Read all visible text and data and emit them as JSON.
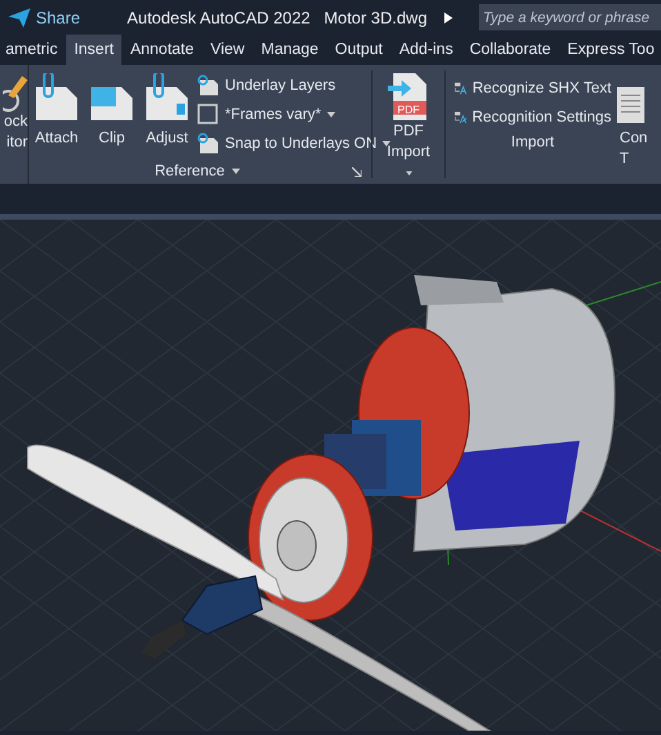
{
  "title_bar": {
    "share": "Share",
    "title": "Autodesk AutoCAD 2022",
    "filename": "Motor 3D.dwg",
    "search": {
      "placeholder": "Type a keyword or phrase"
    }
  },
  "tabs": [
    {
      "label": "ametric",
      "selected": false
    },
    {
      "label": "Insert",
      "selected": true
    },
    {
      "label": "Annotate",
      "selected": false
    },
    {
      "label": "View",
      "selected": false
    },
    {
      "label": "Manage",
      "selected": false
    },
    {
      "label": "Output",
      "selected": false
    },
    {
      "label": "Add-ins",
      "selected": false
    },
    {
      "label": "Collaborate",
      "selected": false
    },
    {
      "label": "Express Too",
      "selected": false
    }
  ],
  "ribbon": {
    "cut_left": [
      "ock",
      "itor"
    ],
    "reference": {
      "title": "Reference",
      "big_buttons": [
        {
          "label": "Attach",
          "kind": "attach"
        },
        {
          "label": "Clip",
          "kind": "clip"
        },
        {
          "label": "Adjust",
          "kind": "adjust"
        }
      ],
      "items": [
        {
          "label": "Underlay Layers",
          "kind": "layers",
          "dropdown": false
        },
        {
          "label": "*Frames vary*",
          "kind": "frames",
          "dropdown": true
        },
        {
          "label": "Snap to Underlays ON",
          "kind": "snap",
          "dropdown": true
        }
      ]
    },
    "pdf_import": {
      "label": "PDF",
      "label_2": "Import",
      "icon_text": "PDF"
    },
    "import": {
      "title": "Import",
      "items": [
        {
          "label": "Recognize SHX Text",
          "kind": "shx"
        },
        {
          "label": "Recognition Settings",
          "kind": "settings"
        }
      ]
    },
    "cut_right": [
      "Con",
      "T"
    ]
  }
}
